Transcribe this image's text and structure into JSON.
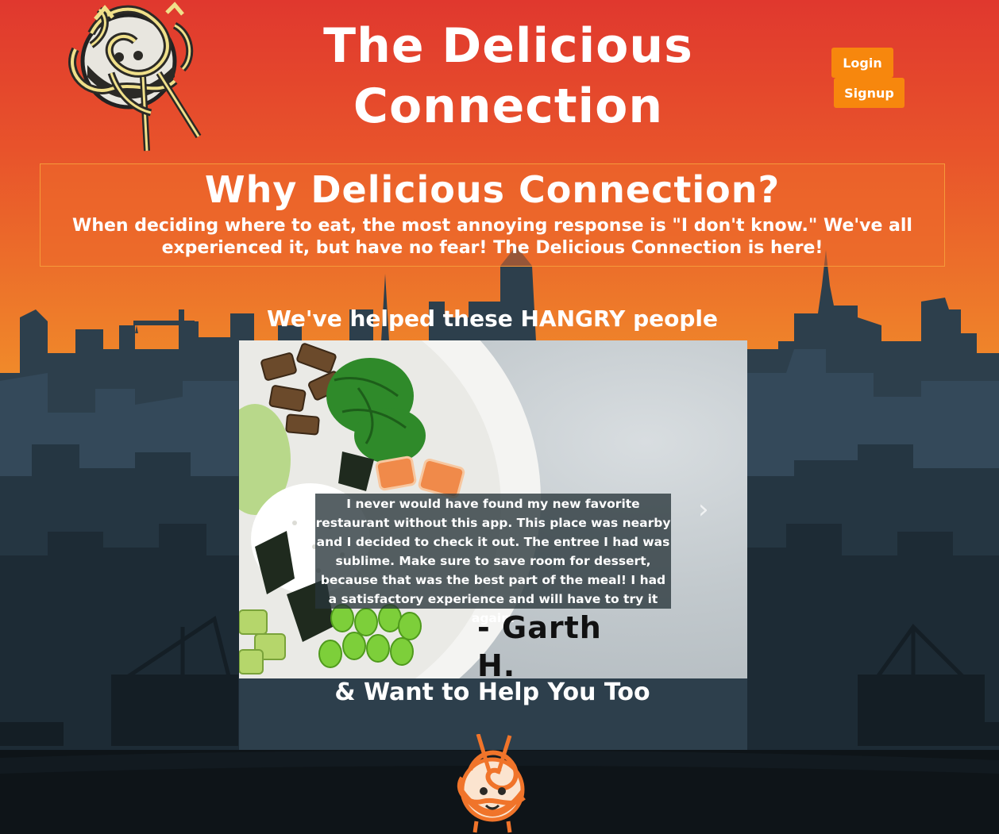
{
  "header": {
    "title_line1": "The Delicious",
    "title_line2": "Connection",
    "logo_icon": "noodle-bowl-logo-icon",
    "login_label": "Login",
    "signup_label": "Signup"
  },
  "why": {
    "heading": "Why Delicious Connection?",
    "text": "When deciding where to eat, the most annoying response is \"I don't know.\" We've all experienced it, but have no fear! The Delicious Connection is here!"
  },
  "testimonials": {
    "heading": "We've helped these HANGRY people",
    "quote": "I never would have found my new favorite restaurant without this app. This place was nearby and I decided to check it out. The entree I had was sublime. Make sure to save room for dessert, because that was the best part of the meal! I had a satisfactory experience and will have to try it again.",
    "author": "- Garth H.",
    "next_icon": "chevron-right-icon",
    "next_glyph": "›"
  },
  "footer": {
    "heading": "& Want to Help You Too",
    "logo_icon": "noodle-bowl-mascot-icon"
  },
  "colors": {
    "gradient_top": "#e0382e",
    "gradient_bottom": "#f3a22e",
    "button_bg": "#f7870d",
    "skyline_dark": "#2a3d4a",
    "ground": "#0e1418"
  }
}
